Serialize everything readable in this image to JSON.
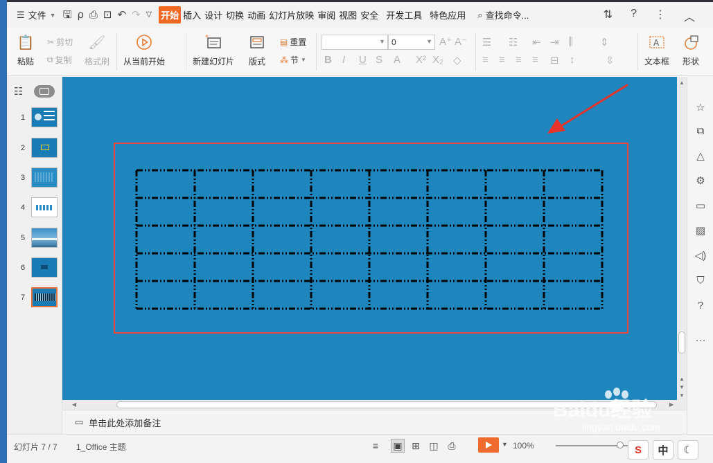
{
  "menubar": {
    "file_label": "文件",
    "tabs": [
      "开始",
      "插入",
      "设计",
      "切换",
      "动画",
      "幻灯片放映",
      "审阅",
      "视图",
      "安全",
      "开发工具",
      "特色应用"
    ],
    "active_tab": "开始",
    "search_label": "查找命令..."
  },
  "ribbon": {
    "paste": "粘贴",
    "cut": "剪切",
    "copy": "复制",
    "format_painter": "格式刷",
    "from_current": "从当前开始",
    "new_slide": "新建幻灯片",
    "layout": "版式",
    "reset": "重置",
    "section": "节",
    "font_size_value": "0",
    "text_box": "文本框",
    "shape": "形状"
  },
  "slides": {
    "numbers": [
      "1",
      "2",
      "3",
      "4",
      "5",
      "6",
      "7"
    ],
    "active_index": 7
  },
  "table": {
    "rows": 5,
    "cols": 8
  },
  "notes": {
    "placeholder": "单击此处添加备注"
  },
  "status": {
    "slide_counter": "幻灯片 7 / 7",
    "theme": "1_Office 主题",
    "zoom": "100%"
  },
  "watermark": {
    "brand": "Baidu经验",
    "url": "jingyan.baidu.com"
  },
  "ime": {
    "lang": "中"
  },
  "colors": {
    "slide_bg": "#1e86bd",
    "highlight_border": "#e8453c",
    "accent_orange": "#ef6b2e",
    "titlebar_blue": "#2e6fb7"
  }
}
